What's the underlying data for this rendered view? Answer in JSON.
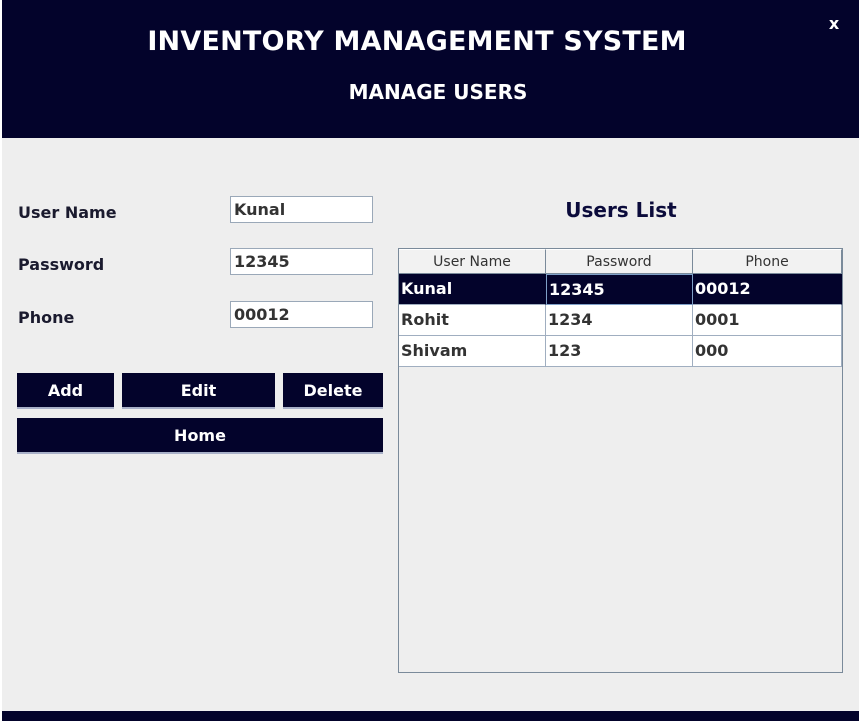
{
  "window": {
    "title": "INVENTORY MANAGEMENT SYSTEM",
    "subtitle": "MANAGE USERS",
    "close_label": "x",
    "accent_color": "#03032b",
    "background_color": "#eeeeee"
  },
  "form": {
    "username": {
      "label": "User Name",
      "value": "Kunal"
    },
    "password": {
      "label": "Password",
      "value": "12345"
    },
    "phone": {
      "label": "Phone",
      "value": "00012"
    }
  },
  "buttons": {
    "add": "Add",
    "edit": "Edit",
    "delete": "Delete",
    "home": "Home"
  },
  "users_list": {
    "title": "Users List",
    "columns": [
      "User Name",
      "Password",
      "Phone"
    ],
    "rows": [
      [
        "Kunal",
        "12345",
        "00012"
      ],
      [
        "Rohit",
        "1234",
        "0001"
      ],
      [
        "Shivam",
        "123",
        "000"
      ]
    ],
    "selected_row": 0
  }
}
